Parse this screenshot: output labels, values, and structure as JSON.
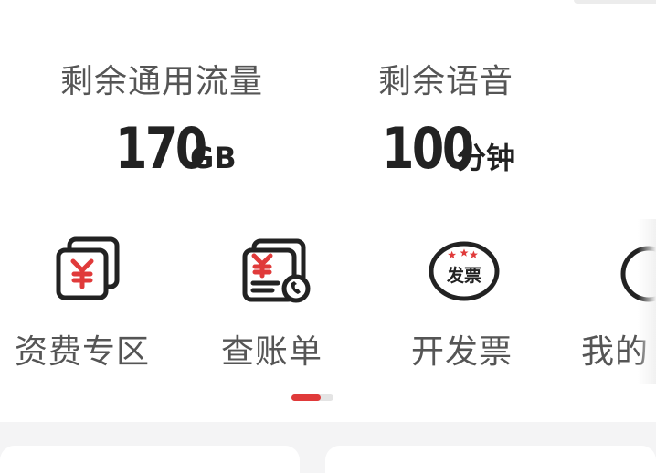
{
  "stats": {
    "data": {
      "label": "剩余通用流量",
      "value": "170",
      "unit": "GB"
    },
    "voice": {
      "label": "剩余语音",
      "value": "100",
      "unit": "分钟"
    }
  },
  "menu": [
    {
      "label": "资费专区",
      "icon": "tariff-yuan-icon"
    },
    {
      "label": "查账单",
      "icon": "bill-icon"
    },
    {
      "label": "开发票",
      "icon": "invoice-icon",
      "icon_text": "发票"
    },
    {
      "label": "我的",
      "icon": "profile-icon"
    }
  ],
  "pager": {
    "pages": 2,
    "current": 1
  },
  "colors": {
    "accent": "#e03a3a",
    "text": "#555555",
    "value": "#222222"
  }
}
